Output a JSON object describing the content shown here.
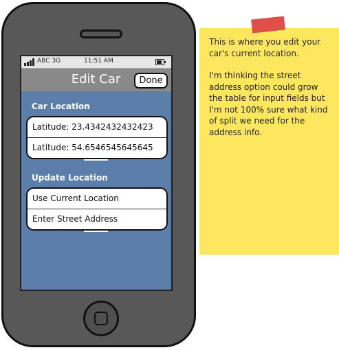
{
  "status_bar": {
    "carrier": "ABC",
    "network": "3G",
    "time": "11:51 AM"
  },
  "nav_bar": {
    "title": "Edit Car",
    "done_label": "Done"
  },
  "car_location": {
    "header": "Car Location",
    "rows": [
      "Latitude: 23.4342432432423",
      "Latitude: 54.6546545645645"
    ]
  },
  "update_location": {
    "header": "Update Location",
    "rows": [
      "Use Current Location",
      "Enter Street Address"
    ]
  },
  "sticky_note": {
    "paragraphs": [
      "This is where you edit your car's current location.",
      "I'm thinking the street address option could grow the table for input fields but I'm not 100% sure what kind of split we need for the address info."
    ]
  },
  "colors": {
    "screen_background": "#5b7faa",
    "nav_bar": "#898989",
    "sticky_note": "#fde75e",
    "tape": "#e0504b",
    "phone_body": "#585858"
  },
  "icons": [
    "signal-icon",
    "battery-icon",
    "home-button-icon"
  ]
}
